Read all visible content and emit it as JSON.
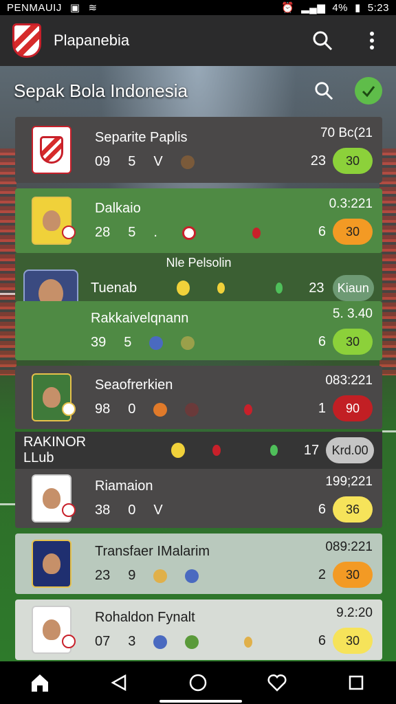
{
  "status_bar": {
    "left_text": "PENMAUIJ",
    "battery": "4%",
    "time": "5:23"
  },
  "app_bar": {
    "title": "Plapanebia"
  },
  "section": {
    "title": "Sepak Bola Indonesia"
  },
  "cards": [
    {
      "name": "Separite Paplis",
      "stats": [
        "09",
        "5",
        "V"
      ],
      "date": "70 Bc(21",
      "num": "23",
      "pill": "30",
      "pill_color": "#8cd13a",
      "num_box_color": "#3b6bb0"
    },
    {
      "name": "Dalkaio",
      "stats": [
        "28",
        "5",
        "."
      ],
      "date": "0.3:221",
      "num": "6",
      "pill": "30",
      "pill_color": "#f39a24"
    },
    {
      "name": "Rakkaivelqnann",
      "stats": [
        "39",
        "5"
      ],
      "date": "5. 3.40",
      "num": "6",
      "pill": "30",
      "pill_color": "#8cd13a"
    },
    {
      "name": "Seaofrerkien",
      "stats": [
        "98",
        "0"
      ],
      "date": "083:221",
      "num": "1",
      "pill": "90",
      "pill_color": "#c21f24"
    },
    {
      "name": "Riamaion",
      "stats": [
        "38",
        "0",
        "V"
      ],
      "date": "199;221",
      "num": "6",
      "pill": "36",
      "pill_color": "#f6e35a"
    },
    {
      "name": "Transfaer IMalarim",
      "stats": [
        "23",
        "9"
      ],
      "date": "089:221",
      "num": "2",
      "pill": "30",
      "pill_color": "#f39a24"
    },
    {
      "name": "Rohaldon Fynalt",
      "stats": [
        "07",
        "3"
      ],
      "date": "9.2:20",
      "num": "6",
      "pill": "30",
      "pill_color": "#f6e35a"
    }
  ],
  "subrow": {
    "label": "Nle Pelsolin",
    "team": "Tuenab",
    "num": "23",
    "pill": "Kiaun"
  },
  "divider": {
    "label": "RAKINOR LLub",
    "num": "17",
    "pill": "Krd.00"
  }
}
